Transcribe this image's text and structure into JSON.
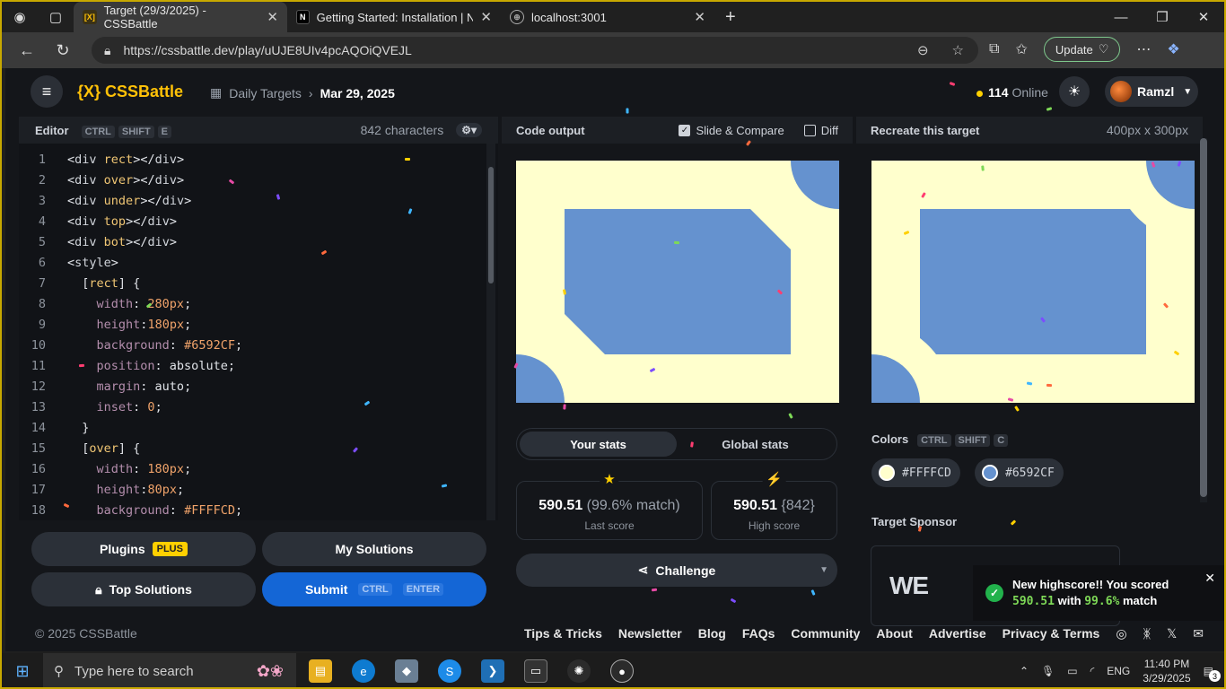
{
  "browser": {
    "tabs": [
      {
        "title": "Target (29/3/2025) - CSSBattle",
        "fav": "[X]",
        "active": true
      },
      {
        "title": "Getting Started: Installation | Next",
        "fav": "N",
        "active": false
      },
      {
        "title": "localhost:3001",
        "fav": "globe",
        "active": false
      }
    ],
    "url": "https://cssbattle.dev/play/uUJE8UIv4pcAQOiQVEJL",
    "update_label": "Update"
  },
  "header": {
    "logo": "{X} CSSBattle",
    "crumb_section": "Daily Targets",
    "crumb_date": "Mar 29, 2025",
    "online_count": "114",
    "online_label": "Online",
    "username": "Ramzl"
  },
  "editor": {
    "title": "Editor",
    "shortcut": [
      "CTRL",
      "SHIFT",
      "E"
    ],
    "char_count": "842 characters",
    "lines": [
      {
        "n": "1",
        "code": "<div rect></div>"
      },
      {
        "n": "2",
        "code": "<div over></div>"
      },
      {
        "n": "3",
        "code": "<div under></div>"
      },
      {
        "n": "4",
        "code": "<div top></div>"
      },
      {
        "n": "5",
        "code": "<div bot></div>"
      },
      {
        "n": "6",
        "code": "<style>"
      },
      {
        "n": "7",
        "code": "  [rect] {"
      },
      {
        "n": "8",
        "code": "    width: 280px;"
      },
      {
        "n": "9",
        "code": "    height:180px;"
      },
      {
        "n": "10",
        "code": "    background: #6592CF;"
      },
      {
        "n": "11",
        "code": "    position: absolute;"
      },
      {
        "n": "12",
        "code": "    margin: auto;"
      },
      {
        "n": "13",
        "code": "    inset: 0;"
      },
      {
        "n": "14",
        "code": "  }"
      },
      {
        "n": "15",
        "code": "  [over] {"
      },
      {
        "n": "16",
        "code": "    width: 180px;"
      },
      {
        "n": "17",
        "code": "    height:80px;"
      },
      {
        "n": "18",
        "code": "    background: #FFFFCD;"
      }
    ],
    "buttons": {
      "plugins": "Plugins",
      "plus": "PLUS",
      "my_solutions": "My Solutions",
      "top_solutions": "Top Solutions",
      "submit": "Submit",
      "submit_keys": [
        "CTRL",
        "ENTER"
      ]
    }
  },
  "output": {
    "title": "Code output",
    "slide_compare": "Slide & Compare",
    "diff": "Diff",
    "tab_your": "Your stats",
    "tab_global": "Global stats",
    "last_score": "590.51",
    "last_match": "(99.6% match)",
    "last_label": "Last score",
    "high_score": "590.51",
    "high_chars": "{842}",
    "high_label": "High score",
    "challenge": "Challenge"
  },
  "target": {
    "title": "Recreate this target",
    "size": "400px x 300px",
    "colors_title": "Colors",
    "colors_keys": [
      "CTRL",
      "SHIFT",
      "C"
    ],
    "colors": [
      {
        "hex": "#FFFFCD"
      },
      {
        "hex": "#6592CF"
      }
    ],
    "sponsor_title": "Target Sponsor",
    "sponsor_logo": "WE"
  },
  "toast": {
    "line1": "New highscore!! You scored",
    "score": "590.51",
    "mid": "with",
    "match": "99.6%",
    "end": "match"
  },
  "footer": {
    "copyright": "© 2025 CSSBattle",
    "links": [
      "Tips & Tricks",
      "Newsletter",
      "Blog",
      "FAQs",
      "Community",
      "About",
      "Advertise",
      "Privacy & Terms"
    ]
  },
  "taskbar": {
    "search_placeholder": "Type here to search",
    "lang": "ENG",
    "time": "11:40 PM",
    "date": "3/29/2025",
    "notif_count": "3"
  },
  "colors": {
    "canvas_bg": "#FFFFCD",
    "shape": "#6592CF",
    "accent": "#FFD000",
    "primary": "#1466D6"
  }
}
